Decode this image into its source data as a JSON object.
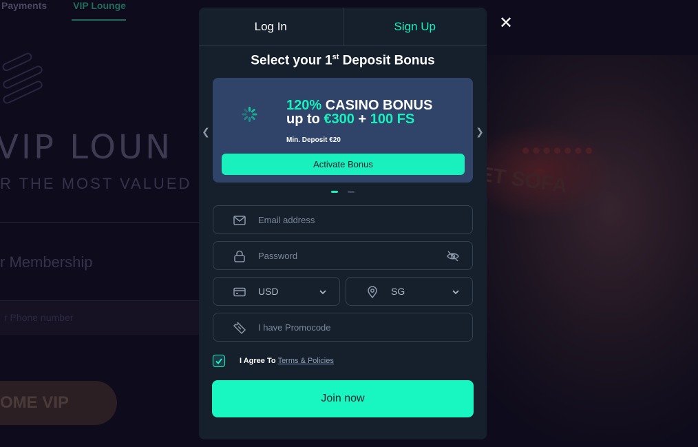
{
  "background": {
    "nav": [
      "Payments",
      "VIP Lounge"
    ],
    "title": "VIP LOUN",
    "subtitle": "R THE MOST VALUED PL",
    "membership": "r Membership",
    "box_text": "r Phone number",
    "vip_button": "OME VIP",
    "sign": "ET SOFA"
  },
  "modal": {
    "tabs": {
      "login": "Log In",
      "signup": "Sign Up"
    },
    "heading": {
      "prefix": "Select your 1",
      "sup": "st",
      "suffix": " Deposit Bonus"
    },
    "bonus": {
      "percent": "120%",
      "type": " CASINO BONUS",
      "up_to": "up to ",
      "amount": "€300",
      "plus": " + ",
      "free_spins": "100 FS",
      "min_deposit": "Min. Deposit €20",
      "activate_label": "Activate Bonus"
    },
    "form": {
      "email_placeholder": "Email address",
      "password_placeholder": "Password",
      "currency": "USD",
      "country": "SG",
      "promocode_placeholder": "I have Promocode",
      "agree_label": "I Agree To",
      "terms_label": "Terms & Policies",
      "join_label": "Join now"
    }
  },
  "colors": {
    "accent": "#18f0bd",
    "modal_bg": "#16202c",
    "card_bg": "#2f4468"
  },
  "icons": [
    "close-icon",
    "chevron-left-icon",
    "chevron-right-icon",
    "spinner-icon",
    "mail-icon",
    "lock-icon",
    "eye-off-icon",
    "card-icon",
    "location-pin-icon",
    "chevron-down-icon",
    "ticket-icon",
    "check-icon"
  ]
}
